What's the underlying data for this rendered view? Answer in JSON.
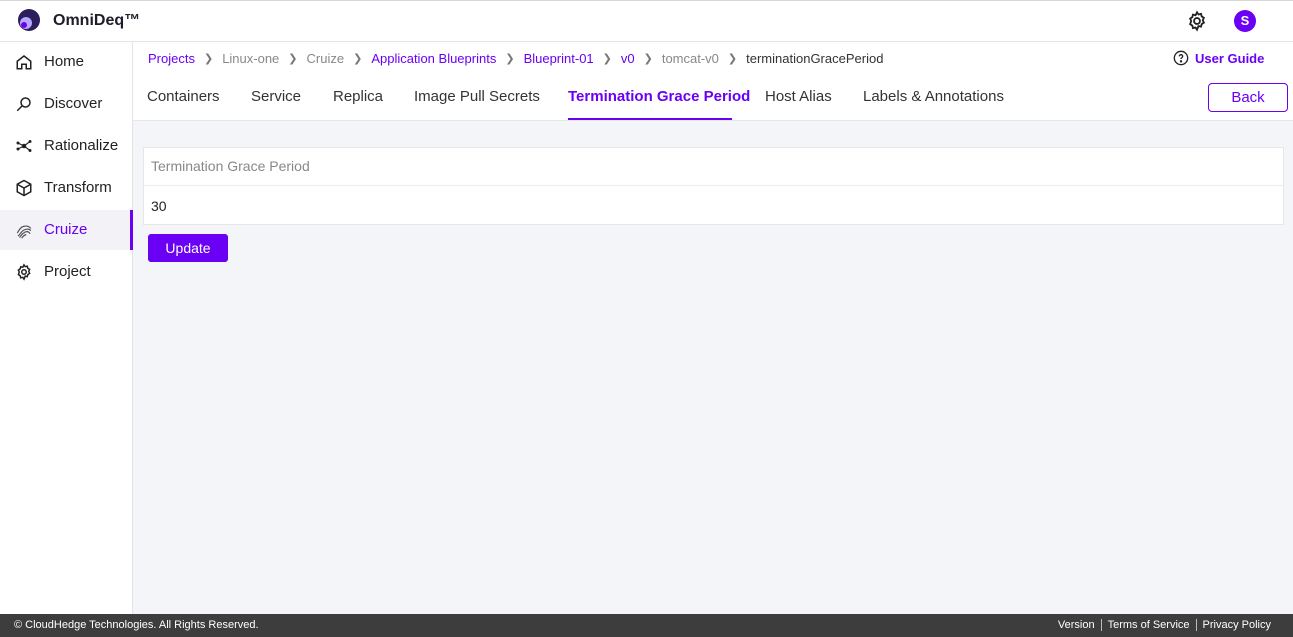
{
  "app": {
    "brand": "OmniDeq™",
    "avatar_initial": "S",
    "accent": "#6a00f4"
  },
  "sidebar": {
    "items": [
      {
        "label": "Home",
        "icon": "home-icon"
      },
      {
        "label": "Discover",
        "icon": "discover-icon"
      },
      {
        "label": "Rationalize",
        "icon": "rationalize-icon"
      },
      {
        "label": "Transform",
        "icon": "cube-icon"
      },
      {
        "label": "Cruize",
        "icon": "fingerprint-icon",
        "active": true
      },
      {
        "label": "Project",
        "icon": "gear-icon"
      }
    ]
  },
  "breadcrumb": [
    "Projects",
    "Linux-one",
    "Cruize",
    "Application Blueprints",
    "Blueprint-01",
    "v0",
    "tomcat-v0",
    "terminationGracePeriod"
  ],
  "user_guide": "User Guide",
  "tabs": [
    "Containers",
    "Service",
    "Replica",
    "Image Pull Secrets",
    "Termination Grace Period",
    "Host Alias",
    "Labels & Annotations"
  ],
  "active_tab": "Termination Grace Period",
  "back_label": "Back",
  "panel": {
    "heading": "Termination Grace Period",
    "value": "30"
  },
  "update_label": "Update",
  "footer": {
    "copyright": "© CloudHedge Technologies. All Rights Reserved.",
    "links": [
      "Version",
      "Terms of Service",
      "Privacy Policy"
    ]
  }
}
